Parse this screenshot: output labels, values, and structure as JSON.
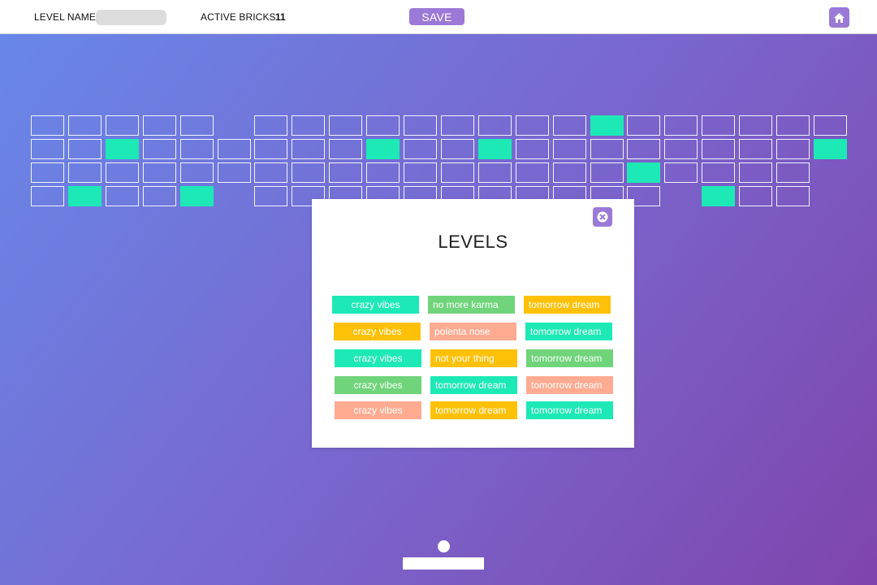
{
  "topbar": {
    "level_name_label": "LEVEL NAME",
    "level_name_value": "",
    "active_bricks_label": "ACTIVE BRICKS",
    "active_bricks_count": "11",
    "save_label": "SAVE",
    "home_icon": "home-icon"
  },
  "colors": {
    "accent": "#9b79d6",
    "brick_active": "#1de9b6",
    "teal": "#1de9b6",
    "green": "#6fd47a",
    "orange": "#ffc107",
    "salmon": "#ffab91"
  },
  "bricks": {
    "rows": [
      [
        0,
        0,
        0,
        0,
        0,
        -1,
        0,
        0,
        0,
        0,
        0,
        0,
        0,
        0,
        0,
        1,
        0,
        0,
        0,
        0,
        0,
        0
      ],
      [
        0,
        0,
        1,
        0,
        0,
        0,
        0,
        0,
        0,
        1,
        0,
        0,
        1,
        0,
        0,
        0,
        0,
        0,
        0,
        0,
        0,
        1
      ],
      [
        0,
        0,
        0,
        0,
        0,
        0,
        0,
        0,
        0,
        0,
        0,
        0,
        0,
        0,
        0,
        0,
        1,
        0,
        0,
        0,
        0,
        -1
      ],
      [
        0,
        1,
        0,
        0,
        1,
        -1,
        0,
        0,
        0,
        0,
        0,
        0,
        0,
        0,
        0,
        0,
        0,
        -1,
        1,
        0,
        0,
        -1
      ]
    ]
  },
  "levels_modal": {
    "title": "LEVELS",
    "close_icon": "close-icon",
    "items": [
      {
        "label": "crazy vibes",
        "color": "teal"
      },
      {
        "label": "no more karma",
        "color": "green"
      },
      {
        "label": "tomorrow dream",
        "color": "orange"
      },
      {
        "label": "crazy vibes",
        "color": "orange"
      },
      {
        "label": "polenta nose",
        "color": "salmon"
      },
      {
        "label": "tomorrow dream",
        "color": "teal"
      },
      {
        "label": "crazy vibes",
        "color": "teal"
      },
      {
        "label": "not your thing",
        "color": "orange"
      },
      {
        "label": "tomorrow dream",
        "color": "green"
      },
      {
        "label": "crazy vibes",
        "color": "green"
      },
      {
        "label": "tomorrow dream",
        "color": "teal"
      },
      {
        "label": "tomorrow dream",
        "color": "salmon"
      },
      {
        "label": "crazy vibes",
        "color": "salmon"
      },
      {
        "label": "tomorrow dream",
        "color": "orange"
      },
      {
        "label": "tomorrow dream",
        "color": "teal"
      }
    ]
  },
  "game": {
    "paddle": "paddle",
    "ball": "ball"
  }
}
